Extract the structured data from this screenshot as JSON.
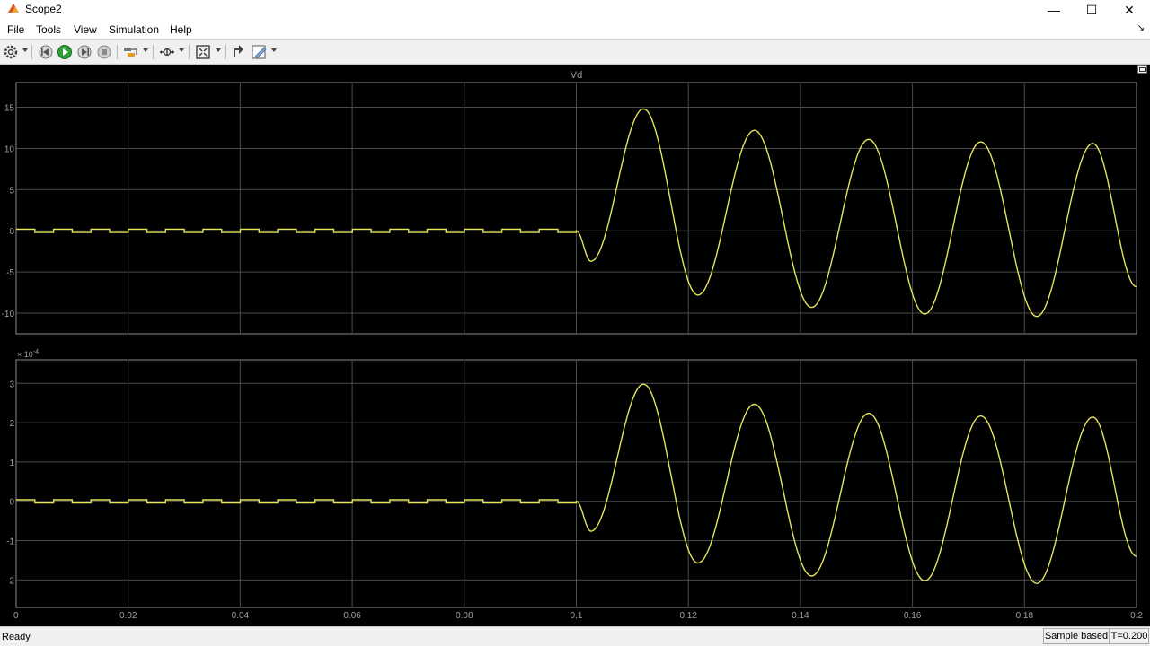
{
  "window": {
    "title": "Scope2",
    "minimize_glyph": "—",
    "maximize_glyph": "☐",
    "close_glyph": "✕"
  },
  "menu": [
    "File",
    "Tools",
    "View",
    "Simulation",
    "Help"
  ],
  "toolbar": {
    "icons": [
      "settings-icon",
      "step-back-icon",
      "run-icon",
      "step-forward-icon",
      "stop-icon",
      "highlight-icon",
      "zoom-icon",
      "autoscale-icon",
      "cursor-measure-icon",
      "style-icon"
    ]
  },
  "scope": {
    "background": "#000000",
    "trace_color": "#e5e55a",
    "grid_color": "#4a4a4a",
    "axis_label_color": "#a0a0a0"
  },
  "status": {
    "ready": "Ready",
    "mode": "Sample based",
    "time": "T=0.200"
  },
  "chart_data": [
    {
      "type": "line",
      "title": "Vd",
      "xlim": [
        0,
        0.2
      ],
      "ylim": [
        -12.5,
        18
      ],
      "yticks": [
        -10,
        -5,
        0,
        5,
        10,
        15
      ],
      "ytick_labels": [
        "-10",
        "-5",
        "0",
        "5",
        "10",
        "15"
      ],
      "xticks": [
        0,
        0.02,
        0.04,
        0.06,
        0.08,
        0.1,
        0.12,
        0.14,
        0.16,
        0.18,
        0.2
      ],
      "xtick_labels": [
        "0",
        "0.02",
        "0.04",
        "0.06",
        "0.08",
        "0.1",
        "0.12",
        "0.14",
        "0.16",
        "0.18",
        "0.2"
      ],
      "grid": true,
      "series": [
        {
          "x": [
            0,
            0.1,
            0.1026,
            0.112,
            0.1217,
            0.1318,
            0.142,
            0.1522,
            0.1622,
            0.1722,
            0.1822,
            0.1922,
            0.2
          ],
          "y": [
            0,
            0,
            -3.7,
            14.8,
            -7.8,
            12.2,
            -9.3,
            11.1,
            -10.1,
            10.8,
            -10.4,
            10.6,
            -6.8
          ]
        }
      ],
      "pre_step_ripple": {
        "x_range": [
          0,
          0.1
        ],
        "amplitude": 0.2,
        "period": 0.00667
      }
    },
    {
      "type": "line",
      "title": "",
      "y_exponent_label": "× 10",
      "y_exponent": "-4",
      "xlim": [
        0,
        0.2
      ],
      "ylim": [
        -2.7,
        3.6
      ],
      "yticks": [
        -2,
        -1,
        0,
        1,
        2,
        3
      ],
      "ytick_labels": [
        "-2",
        "-1",
        "0",
        "1",
        "2",
        "3"
      ],
      "xticks": [
        0,
        0.02,
        0.04,
        0.06,
        0.08,
        0.1,
        0.12,
        0.14,
        0.16,
        0.18,
        0.2
      ],
      "xtick_labels": [
        "0",
        "0.02",
        "0.04",
        "0.06",
        "0.08",
        "0.1",
        "0.12",
        "0.14",
        "0.16",
        "0.18",
        "0.2"
      ],
      "grid": true,
      "series": [
        {
          "x": [
            0,
            0.1,
            0.1026,
            0.112,
            0.1217,
            0.1318,
            0.142,
            0.1522,
            0.1622,
            0.1722,
            0.1822,
            0.1922,
            0.2
          ],
          "y": [
            0,
            0,
            -0.76,
            2.98,
            -1.57,
            2.47,
            -1.9,
            2.24,
            -2.02,
            2.17,
            -2.09,
            2.14,
            -1.4
          ]
        }
      ],
      "pre_step_ripple": {
        "x_range": [
          0,
          0.1
        ],
        "amplitude": 0.04,
        "period": 0.00667
      }
    }
  ]
}
